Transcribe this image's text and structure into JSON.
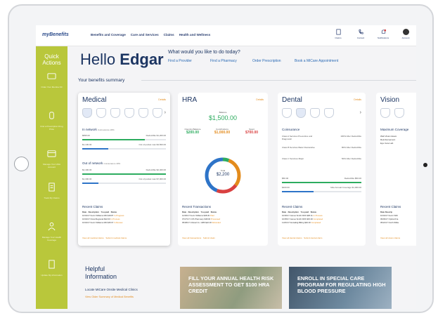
{
  "app": {
    "logo": "myBenefits",
    "nav": [
      "Benefits and Coverage",
      "Care and Services",
      "Claims",
      "Health and Wellness"
    ],
    "toolbar": [
      {
        "icon": "document-icon",
        "label": "Claims"
      },
      {
        "icon": "phone-icon",
        "label": "Contact"
      },
      {
        "icon": "bell-icon",
        "label": "Notifications"
      },
      {
        "icon": "avatar-icon",
        "label": "Account"
      }
    ]
  },
  "sidebar": {
    "title": "Quick Actions",
    "items": [
      {
        "icon": "card-icon",
        "label": "Order Your Member ID"
      },
      {
        "icon": "pharmacy-icon",
        "label": "Find a Prescription Drug Price"
      },
      {
        "icon": "wallet-icon",
        "label": "Manage Your HSA Account"
      },
      {
        "icon": "checklist-icon",
        "label": "Track My Claims"
      },
      {
        "icon": "doctor-icon",
        "label": "Manage Your Health Coverage"
      },
      {
        "icon": "forms-icon",
        "label": "Update My Information"
      }
    ]
  },
  "greeting": {
    "hello": "Hello",
    "name": "Edgar"
  },
  "question": "What would you like to do today?",
  "quick_links": [
    "Find a Provider",
    "Find a Pharmacy",
    "Order Prescription",
    "Book a MiCare Appointment"
  ],
  "summary_title": "Your benefits summary",
  "medical": {
    "title": "Medical",
    "details": "Details",
    "family": [
      "Family",
      "Edgar",
      "Maria",
      "Wendy",
      "Ricardo",
      "Loles"
    ],
    "in_network": "In network",
    "in_net_tag": "Coinsurance 20%",
    "rows_in": [
      {
        "l": "$895.00",
        "r": "Deductible $1,200.00",
        "fill": 0.75,
        "color": "green"
      },
      {
        "l": "$1,100.00",
        "r": "Out of pocket max $3,500.00",
        "fill": 0.31,
        "color": "blue"
      }
    ],
    "out_network": "Out of network",
    "out_net_tag": "Coinsurance 40%",
    "rows_out": [
      {
        "l": "$2,400.00",
        "r": "Deductible $2,400.00",
        "fill": 1.0,
        "color": "green"
      },
      {
        "l": "$1,300.00",
        "r": "Out of pocket max $7,000.00",
        "fill": 0.19,
        "color": "blue"
      }
    ],
    "recent": "Recent Claims",
    "cols": [
      "Date",
      "Description",
      "You paid",
      "Status"
    ],
    "claims": [
      [
        "10/04/17",
        "Kevin Williams MD",
        "$18.87",
        "In Progress"
      ],
      [
        "10/04/17",
        "Doral Regional",
        "$42.00",
        "In Process"
      ],
      [
        "10/04/17",
        "Kevin Williams MD",
        "$45.67",
        "In Review"
      ]
    ],
    "links": [
      "View all medical claims",
      "Submit medical claims"
    ]
  },
  "hra": {
    "title": "HRA",
    "details": "Details",
    "bal_label": "Balance",
    "balance": "$1,500.00",
    "tri": [
      {
        "l": "Opening Balance",
        "v": "$200.00",
        "c": "#2dac5f"
      },
      {
        "l": "Contributions",
        "v": "$1,000.00",
        "c": "#e38b1c"
      },
      {
        "l": "Spent",
        "v": "$700.00",
        "c": "#d94040"
      }
    ],
    "donut_label": "Total",
    "donut_value": "$2,200",
    "recent": "Recent Transactions",
    "cols": [
      "Date",
      "Description",
      "You paid",
      "Status"
    ],
    "tx": [
      [
        "12/06/17",
        "Kevin Williams",
        "$38.00",
        "Paid"
      ],
      [
        "07/27/17",
        "CVS Pharmacy",
        "$48.00",
        "Processed"
      ],
      [
        "05/08/17",
        "Clinical Vs. 1386",
        "$22.00",
        "Refunded"
      ]
    ],
    "links": [
      "View all transactions",
      "Submit claim"
    ]
  },
  "dental": {
    "title": "Dental",
    "details": "Details",
    "family": [
      "You",
      "Dependent",
      "Edgar",
      "Pres"
    ],
    "coins": "Coinsurance",
    "items": [
      {
        "l": "Class A Services Preventive and Diagnostic",
        "r": "100% After Deductible"
      },
      {
        "l": "Class B Services Basic Restorative",
        "r": "80% After Deductible"
      },
      {
        "l": "Class C Services Major",
        "r": "50% After Deductible"
      }
    ],
    "row1": {
      "l": "$50.00",
      "r": "Deductible $50.00",
      "fill": 1.0,
      "color": "green"
    },
    "row2": {
      "l": "$400.00",
      "r": "Max Annual Coverage $1,000.00",
      "fill": 0.4,
      "color": "blue"
    },
    "recent": "Recent Claims",
    "cols": [
      "Date",
      "Description",
      "You paid",
      "Status"
    ],
    "claims": [
      [
        "10/06/17",
        "James Smith DDS",
        "$38.11",
        "In Process"
      ],
      [
        "10/05/17",
        "James Smith DDS",
        "$15.00",
        "Completed"
      ],
      [
        "11/25/17",
        "Dentalidg Billing",
        "$40.00",
        "Completed"
      ]
    ],
    "links": [
      "View all dental claims",
      "Submit dental claim"
    ]
  },
  "vision": {
    "title": "Vision",
    "coverage": "Maximum Coverage",
    "items": [
      "Well Vision Exam",
      "Reimbursement",
      "Eye Care Lab"
    ],
    "recent": "Recent Claims",
    "claims": [
      [
        "Date",
        "Descrip"
      ],
      [
        "10/04/17",
        "Kevin Willi"
      ],
      [
        "09/09/17",
        "Optical Fra"
      ],
      [
        "05/22/17",
        "North Willia"
      ]
    ],
    "link": "View all vision claims"
  },
  "helpful": {
    "title": "Helpful Information",
    "link1": "Locate MiCare Onsite Medical Clinics",
    "link2": "View Older Summary of Medical Benefits"
  },
  "banners": [
    "FILL YOUR ANNUAL HEALTH RISK ASSESSMENT TO GET $100 HRA CREDIT",
    "ENROLL IN SPECIAL CARE PROGRAM FOR REGULATING HIGH BLOOD PRESSURE"
  ],
  "hra_chart": {
    "type": "pie",
    "segments": [
      {
        "label": "Opening Balance",
        "value": 200,
        "color": "#2dac5f"
      },
      {
        "label": "Contributions",
        "value": 1000,
        "color": "#e38b1c"
      },
      {
        "label": "Spent",
        "value": 700,
        "color": "#d94040"
      },
      {
        "label": "Balance",
        "value": 1500,
        "color": "#2e74c8"
      }
    ]
  }
}
